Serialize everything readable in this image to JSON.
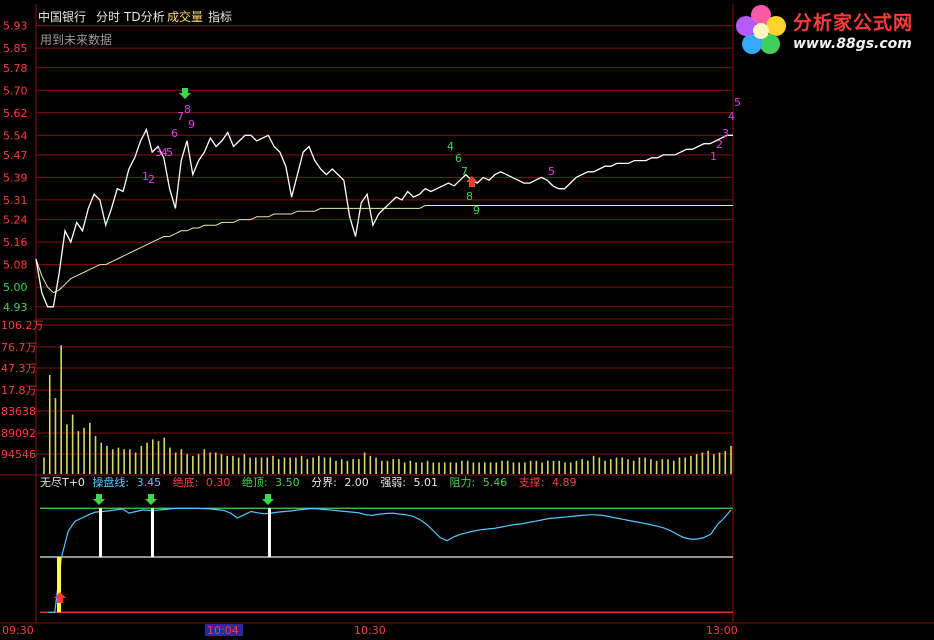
{
  "menu": {
    "stock_name": "中国银行",
    "items": [
      "分时",
      "TD分析",
      "成交量",
      "指标"
    ]
  },
  "note": "用到未来数据",
  "logo": {
    "name": "分析家公式网",
    "url": "www.88gs.com"
  },
  "price_axis": {
    "labels": [
      "5.93",
      "5.85",
      "5.78",
      "5.70",
      "5.62",
      "5.54",
      "5.47",
      "5.39",
      "5.31",
      "5.24",
      "5.16",
      "5.08",
      "5.00",
      "4.93"
    ]
  },
  "volume_axis": {
    "labels": [
      "106.2万",
      "76.7万",
      "47.3万",
      "17.8万",
      "83638",
      "89092",
      "94546"
    ]
  },
  "time_axis": {
    "labels": [
      "09:30",
      "10:04",
      "10:30",
      "13:00"
    ],
    "highlighted": "10:04"
  },
  "indicator": {
    "name": "无尽T+0",
    "fields": [
      {
        "label": "操盘线:",
        "value": "3.45",
        "color": "#52c8ff"
      },
      {
        "label": "绝底:",
        "value": "0.30",
        "color": "#ff3b3b"
      },
      {
        "label": "绝顶:",
        "value": "3.50",
        "color": "#3ed64a"
      },
      {
        "label": "分界:",
        "value": "2.00",
        "color": "#e6e6e6"
      },
      {
        "label": "强弱:",
        "value": "5.01",
        "color": "#e6e6e6"
      },
      {
        "label": "阻力:",
        "value": "5.46",
        "color": "#3ed64a"
      },
      {
        "label": "支撑:",
        "value": "4.89",
        "color": "#ff3b3b"
      }
    ]
  },
  "colors": {
    "grid": "#8a1010",
    "up": "#ff3b3b",
    "down": "#3ed64a",
    "price_line": "#ffffff",
    "avg_line": "#e8e8a0",
    "volume": "#d8d860",
    "indicator_line": "#52c8ff",
    "td_up": "#e040e0",
    "td_down": "#3ed64a"
  },
  "chart_data": {
    "type": "line",
    "price": {
      "ylim": [
        4.89,
        5.95
      ],
      "x_minutes": [
        0,
        2,
        4,
        6,
        8,
        10,
        12,
        14,
        16,
        18,
        20,
        22,
        24,
        26,
        28,
        30,
        32,
        34,
        36,
        38,
        40,
        42,
        44,
        46,
        48,
        50,
        52,
        54,
        56,
        58,
        60,
        62,
        64,
        66,
        68,
        70,
        72,
        74,
        76,
        78,
        80,
        82,
        84,
        86,
        88,
        90,
        92,
        94,
        96,
        98,
        100,
        102,
        104,
        106,
        108,
        110,
        112,
        114,
        116,
        118,
        120,
        122,
        124,
        126,
        128,
        130,
        132,
        134,
        136,
        138,
        140,
        142,
        144,
        146,
        148,
        150,
        152,
        154,
        156,
        158,
        160,
        162,
        164,
        166,
        168,
        170,
        172,
        174,
        176,
        178,
        180,
        182,
        184,
        186,
        188,
        190,
        192,
        194,
        196,
        198,
        200,
        202,
        204,
        206,
        208,
        210,
        212,
        214,
        216,
        218,
        220,
        222,
        224,
        226,
        228,
        230,
        232,
        234,
        236,
        238,
        240
      ],
      "series": [
        {
          "values": [
            5.1,
            4.98,
            4.93,
            4.93,
            5.05,
            5.2,
            5.16,
            5.23,
            5.2,
            5.28,
            5.33,
            5.31,
            5.22,
            5.28,
            5.35,
            5.34,
            5.42,
            5.46,
            5.52,
            5.56,
            5.48,
            5.5,
            5.46,
            5.35,
            5.28,
            5.45,
            5.52,
            5.4,
            5.45,
            5.48,
            5.53,
            5.5,
            5.52,
            5.55,
            5.5,
            5.52,
            5.54,
            5.54,
            5.52,
            5.53,
            5.54,
            5.5,
            5.48,
            5.43,
            5.32,
            5.4,
            5.48,
            5.5,
            5.45,
            5.42,
            5.4,
            5.42,
            5.4,
            5.38,
            5.25,
            5.18,
            5.3,
            5.33,
            5.22,
            5.26,
            5.28,
            5.3,
            5.32,
            5.31,
            5.34,
            5.32,
            5.33,
            5.35,
            5.34,
            5.35,
            5.36,
            5.37,
            5.36,
            5.38,
            5.4,
            5.38,
            5.37,
            5.39,
            5.38,
            5.4,
            5.41,
            5.4,
            5.39,
            5.38,
            5.37,
            5.37,
            5.38,
            5.39,
            5.38,
            5.36,
            5.35,
            5.35,
            5.37,
            5.39,
            5.4,
            5.41,
            5.41,
            5.42,
            5.43,
            5.43,
            5.44,
            5.44,
            5.44,
            5.45,
            5.45,
            5.45,
            5.46,
            5.46,
            5.47,
            5.47,
            5.47,
            5.48,
            5.49,
            5.49,
            5.5,
            5.51,
            5.51,
            5.52,
            5.53,
            5.54,
            5.54
          ]
        },
        {
          "values": [
            5.1,
            5.04,
            5.0,
            4.98,
            4.99,
            5.01,
            5.03,
            5.04,
            5.05,
            5.06,
            5.07,
            5.08,
            5.08,
            5.09,
            5.1,
            5.11,
            5.12,
            5.13,
            5.14,
            5.15,
            5.16,
            5.17,
            5.18,
            5.18,
            5.19,
            5.2,
            5.2,
            5.21,
            5.21,
            5.22,
            5.22,
            5.22,
            5.23,
            5.23,
            5.23,
            5.24,
            5.24,
            5.24,
            5.25,
            5.25,
            5.25,
            5.26,
            5.26,
            5.26,
            5.26,
            5.27,
            5.27,
            5.27,
            5.27,
            5.28,
            5.28,
            5.28,
            5.28,
            5.28,
            5.28,
            5.28,
            5.28,
            5.28,
            5.28,
            5.28,
            5.28,
            5.28,
            5.28,
            5.28,
            5.28,
            5.28,
            5.28,
            5.29,
            5.29,
            5.29,
            5.29,
            5.29,
            5.29,
            5.29,
            5.29,
            5.29,
            5.29,
            5.29,
            5.29,
            5.29,
            5.29,
            5.29,
            5.29,
            5.29,
            5.29,
            5.29,
            5.29,
            5.29,
            5.29,
            5.29,
            5.29,
            5.29,
            5.29,
            5.29,
            5.29,
            5.29,
            5.29,
            5.29,
            5.29,
            5.29,
            5.29,
            5.29,
            5.29,
            5.29,
            5.29,
            5.29,
            5.29,
            5.29,
            5.29,
            5.29,
            5.29,
            5.29,
            5.29,
            5.29,
            5.29,
            5.29,
            5.29,
            5.29,
            5.29,
            5.29,
            5.29
          ]
        }
      ]
    },
    "volume": {
      "values": [
        10,
        60,
        46,
        78,
        30,
        36,
        26,
        28,
        31,
        23,
        19,
        17,
        15,
        16,
        15,
        15,
        13,
        17,
        19,
        21,
        20,
        22,
        16,
        13,
        15,
        12,
        11,
        12,
        15,
        13,
        13,
        12,
        11,
        11,
        10,
        12,
        10,
        10,
        10,
        10,
        11,
        9,
        10,
        10,
        10,
        11,
        9,
        10,
        11,
        10,
        10,
        8,
        9,
        8,
        9,
        9,
        13,
        11,
        10,
        8,
        8,
        9,
        9,
        7,
        8,
        7,
        7,
        8,
        7,
        7,
        7,
        7,
        7,
        8,
        8,
        7,
        7,
        7,
        7,
        7,
        8,
        8,
        7,
        7,
        7,
        8,
        8,
        7,
        8,
        8,
        8,
        7,
        7,
        8,
        9,
        8,
        11,
        10,
        8,
        9,
        10,
        10,
        9,
        8,
        10,
        10,
        9,
        8,
        9,
        9,
        8,
        10,
        10,
        11,
        12,
        13,
        14,
        12,
        13,
        14,
        17
      ]
    },
    "indicator": {
      "ylim": [
        0,
        4
      ],
      "levels": {
        "top": 3.5,
        "mid": 2.0,
        "bottom": 0.3
      },
      "values": [
        0.3,
        0.3,
        2.0,
        2.8,
        3.1,
        3.2,
        3.3,
        3.38,
        3.4,
        3.42,
        3.45,
        3.48,
        3.35,
        3.4,
        3.45,
        3.43,
        3.44,
        3.46,
        3.48,
        3.5,
        3.5,
        3.5,
        3.5,
        3.49,
        3.48,
        3.46,
        3.43,
        3.35,
        3.2,
        3.3,
        3.4,
        3.36,
        3.33,
        3.35,
        3.38,
        3.4,
        3.42,
        3.45,
        3.47,
        3.49,
        3.48,
        3.46,
        3.44,
        3.42,
        3.4,
        3.38,
        3.36,
        3.3,
        3.28,
        3.32,
        3.34,
        3.35,
        3.32,
        3.3,
        3.25,
        3.15,
        3.0,
        2.8,
        2.6,
        2.5,
        2.62,
        2.7,
        2.75,
        2.8,
        2.84,
        2.86,
        2.88,
        2.92,
        2.96,
        3.0,
        3.02,
        3.06,
        3.1,
        3.14,
        3.18,
        3.2,
        3.22,
        3.24,
        3.26,
        3.28,
        3.3,
        3.3,
        3.28,
        3.24,
        3.2,
        3.16,
        3.12,
        3.08,
        3.04,
        3.0,
        2.95,
        2.9,
        2.82,
        2.7,
        2.6,
        2.55,
        2.55,
        2.6,
        2.7,
        3.0,
        3.2,
        3.45
      ]
    }
  }
}
